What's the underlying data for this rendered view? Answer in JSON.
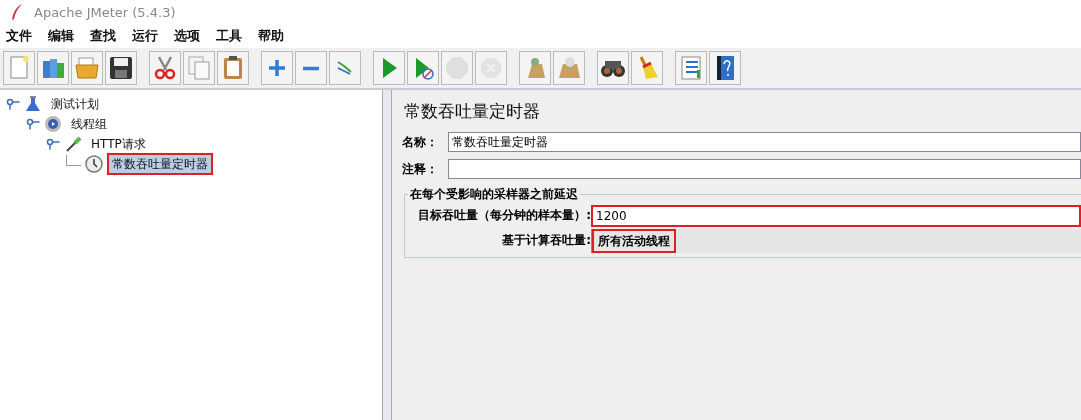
{
  "window": {
    "title": "Apache JMeter (5.4.3)"
  },
  "menu": [
    "文件",
    "编辑",
    "查找",
    "运行",
    "选项",
    "工具",
    "帮助"
  ],
  "toolbar": [
    [
      {
        "kind": "new",
        "disabled": false
      },
      {
        "kind": "templates",
        "disabled": false
      },
      {
        "kind": "open",
        "disabled": false
      },
      {
        "kind": "save",
        "disabled": false
      }
    ],
    [
      {
        "kind": "cut",
        "disabled": false
      },
      {
        "kind": "copy",
        "disabled": false
      },
      {
        "kind": "paste",
        "disabled": false
      }
    ],
    [
      {
        "kind": "expand",
        "disabled": false
      },
      {
        "kind": "collapse",
        "disabled": false
      },
      {
        "kind": "toggle",
        "disabled": false
      }
    ],
    [
      {
        "kind": "start",
        "disabled": false
      },
      {
        "kind": "start-no-pause",
        "disabled": false
      },
      {
        "kind": "stop",
        "disabled": true
      },
      {
        "kind": "shutdown",
        "disabled": true
      }
    ],
    [
      {
        "kind": "clear",
        "disabled": false
      },
      {
        "kind": "clear-all",
        "disabled": false
      }
    ],
    [
      {
        "kind": "search",
        "disabled": false
      },
      {
        "kind": "reset",
        "disabled": false
      }
    ],
    [
      {
        "kind": "functions",
        "disabled": false
      },
      {
        "kind": "help",
        "disabled": false
      }
    ]
  ],
  "tree": [
    {
      "label": "测试计划",
      "kind": "plan",
      "selected": false,
      "expanded": true,
      "highlighted": false,
      "children": [
        {
          "label": "线程组",
          "kind": "threads",
          "selected": false,
          "expanded": true,
          "highlighted": false,
          "children": [
            {
              "label": "HTTP请求",
              "kind": "sampler",
              "selected": false,
              "expanded": true,
              "highlighted": false,
              "children": [
                {
                  "label": "常数吞吐量定时器",
                  "kind": "timer",
                  "selected": true,
                  "highlighted": true
                }
              ]
            }
          ]
        }
      ]
    }
  ],
  "panel": {
    "title": "常数吞吐量定时器",
    "name": {
      "label": "名称：",
      "value": "常数吞吐量定时器"
    },
    "comment": {
      "label": "注释："
    },
    "group": {
      "title": "在每个受影响的采样器之前延迟",
      "throughput": {
        "label": "目标吞吐量（每分钟的样本量）:",
        "value": "1200",
        "highlighted": true
      },
      "calc": {
        "label": "基于计算吞吐量:",
        "value": "所有活动线程",
        "highlighted": true
      }
    }
  }
}
